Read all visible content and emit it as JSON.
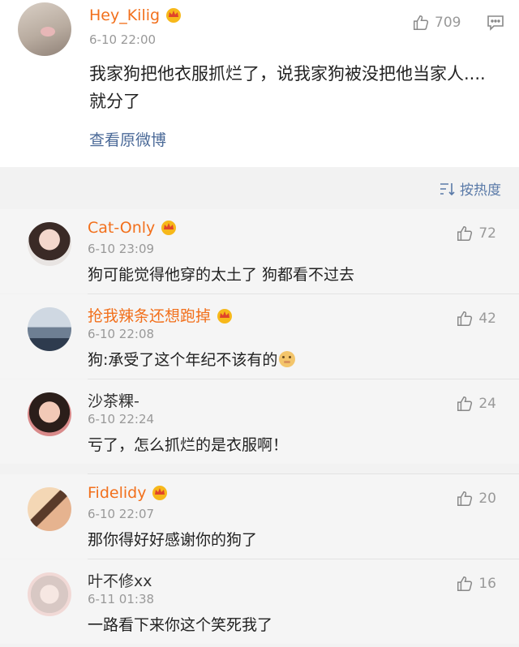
{
  "post": {
    "username": "Hey_Kilig",
    "time": "6-10 22:00",
    "likes": "709",
    "content": "我家狗把他衣服抓烂了，说我家狗被没把他当家人....就分了",
    "view_original": "查看原微博"
  },
  "sort": {
    "label": "按热度"
  },
  "comments": [
    {
      "username": "Cat-Only",
      "vip": true,
      "time": "6-10 23:09",
      "likes": "72",
      "text": "狗可能觉得他穿的太土了 狗都看不过去"
    },
    {
      "username": "抢我辣条还想跑掉",
      "vip": true,
      "time": "6-10 22:08",
      "likes": "42",
      "text": "狗:承受了这个年纪不该有的"
    },
    {
      "username": "沙茶粿-",
      "vip": false,
      "time": "6-10 22:24",
      "likes": "24",
      "text": "亏了，怎么抓烂的是衣服啊！"
    },
    {
      "username": "Fidelidy",
      "vip": true,
      "time": "6-10 22:07",
      "likes": "20",
      "text": "那你得好好感谢你的狗了"
    },
    {
      "username": "叶不修xx",
      "vip": false,
      "time": "6-11 01:38",
      "likes": "16",
      "text": "一路看下来你这个笑死我了"
    }
  ],
  "colors": {
    "vip_name": "#f2701c",
    "link": "#4b6a98",
    "meta": "#999999"
  }
}
